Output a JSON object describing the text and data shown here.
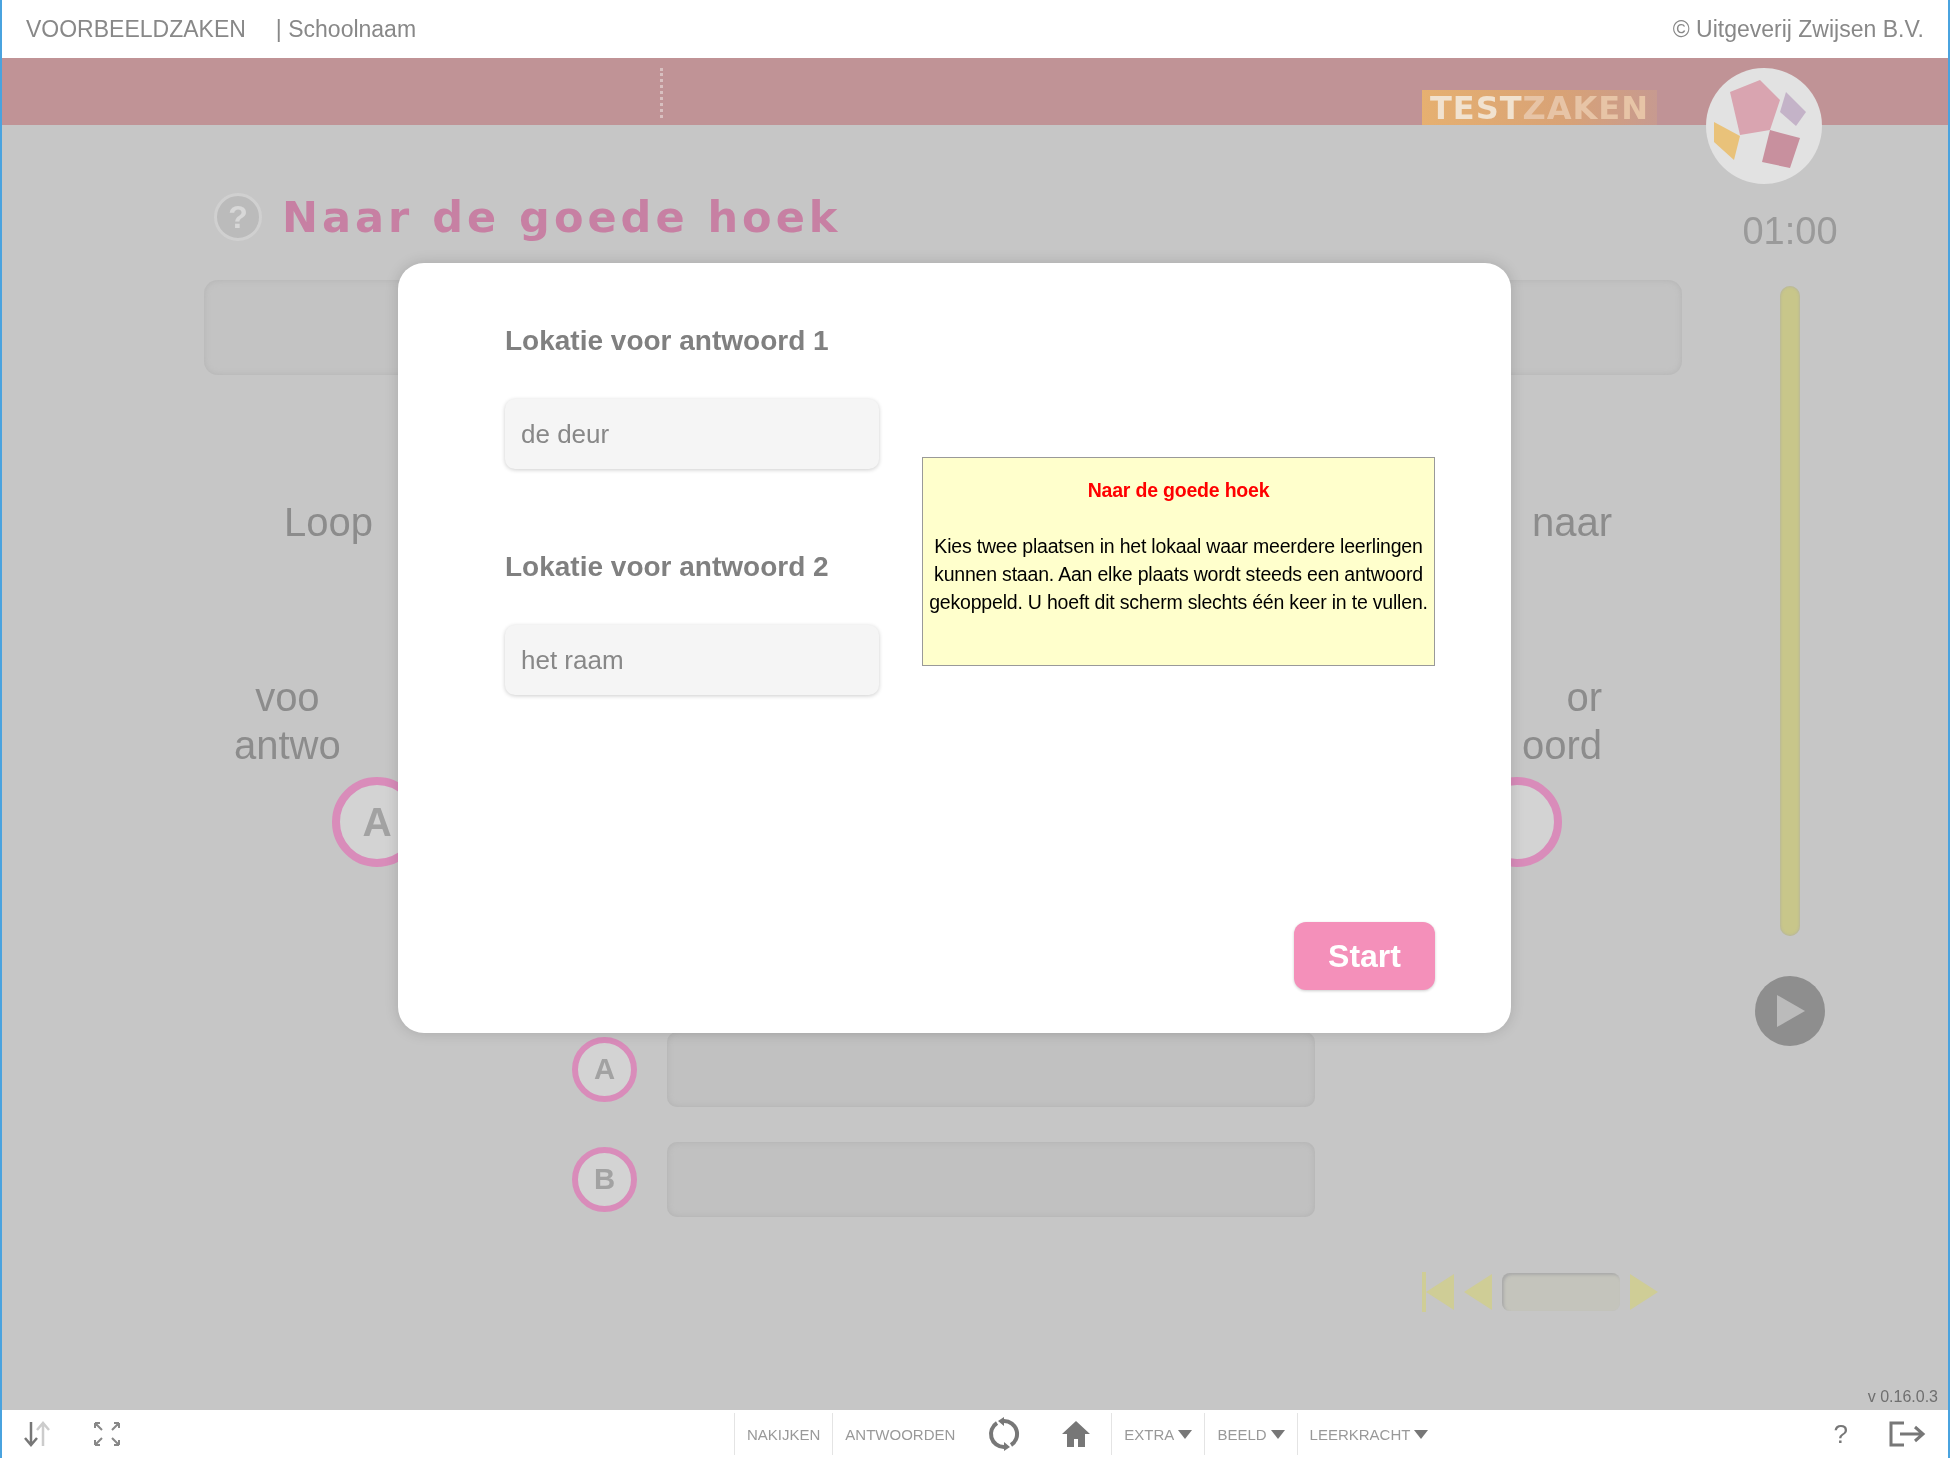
{
  "header": {
    "brand": "VOORBEELDZAKEN",
    "school": "| Schoolnaam",
    "copyright": "© Uitgeverij Zwijsen B.V."
  },
  "logo_parts": [
    "TEST",
    "ZAKEN"
  ],
  "exercise": {
    "help": "?",
    "title": "Naar de goede hoek",
    "timer": "01:00"
  },
  "question": {
    "left": "Loop",
    "right": "naar",
    "left_label": [
      "voo",
      "antwo"
    ],
    "right_label": [
      "or",
      "oord"
    ],
    "left_choice": "A"
  },
  "answers": [
    {
      "letter": "A"
    },
    {
      "letter": "B"
    }
  ],
  "version": "v 0.16.0.3",
  "toolbar": [
    {
      "kind": "text",
      "label": "NAKIJKEN"
    },
    {
      "kind": "text",
      "label": "ANTWOORDEN"
    },
    {
      "kind": "refresh"
    },
    {
      "kind": "home"
    },
    {
      "kind": "menu",
      "label": "EXTRA"
    },
    {
      "kind": "menu",
      "label": "BEELD"
    },
    {
      "kind": "menu",
      "label": "LEERKRACHT"
    }
  ],
  "help_button": "?",
  "dialog": {
    "fields": [
      {
        "label": "Lokatie voor antwoord 1",
        "value": "de deur"
      },
      {
        "label": "Lokatie voor antwoord 2",
        "value": "het raam"
      }
    ],
    "info": {
      "title": "Naar de goede hoek",
      "body": "Kies twee plaatsen in het lokaal waar meerdere leerlingen kunnen staan. Aan elke plaats wordt steeds een antwoord gekoppeld. U hoeft dit scherm slechts één keer in te vullen."
    },
    "button": "Start"
  }
}
